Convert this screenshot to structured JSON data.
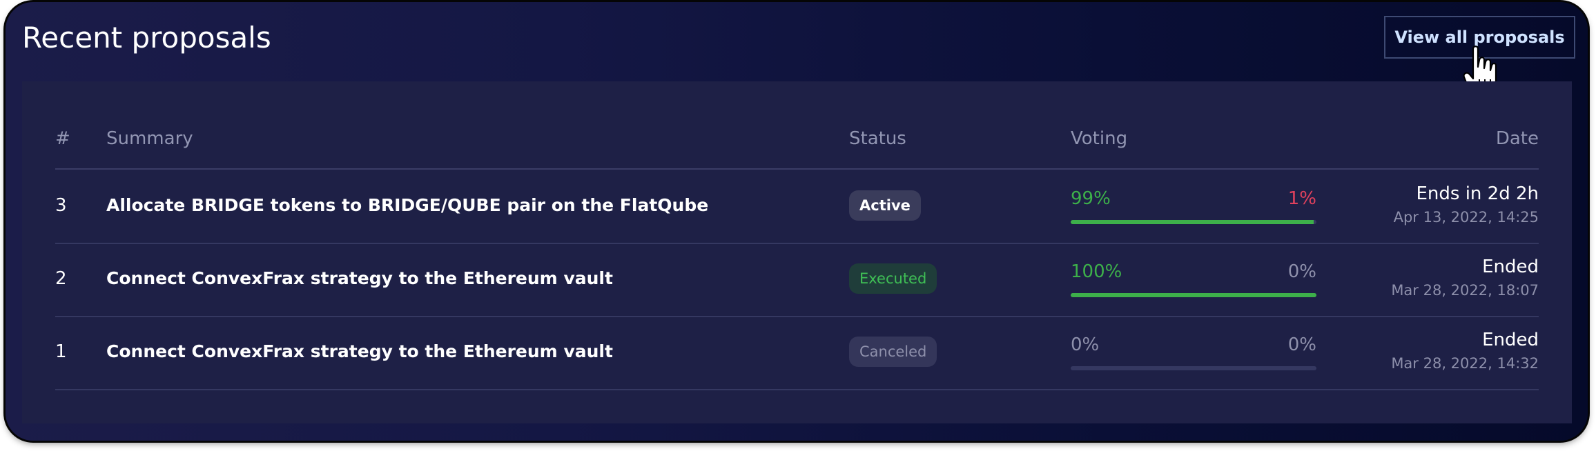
{
  "header": {
    "title": "Recent proposals",
    "view_all_label": "View all proposals"
  },
  "table": {
    "columns": {
      "number": "#",
      "summary": "Summary",
      "status": "Status",
      "voting": "Voting",
      "date": "Date"
    },
    "rows": [
      {
        "number": "3",
        "summary": "Allocate BRIDGE tokens to BRIDGE/QUBE pair on the FlatQube",
        "status": "Active",
        "yes": "99%",
        "no": "1%",
        "yes_fraction": 0.99,
        "date_main": "Ends in 2d 2h",
        "date_sub": "Apr 13, 2022, 14:25"
      },
      {
        "number": "2",
        "summary": "Connect ConvexFrax strategy to the Ethereum vault",
        "status": "Executed",
        "yes": "100%",
        "no": "0%",
        "yes_fraction": 1.0,
        "date_main": "Ended",
        "date_sub": "Mar 28, 2022, 18:07"
      },
      {
        "number": "1",
        "summary": "Connect ConvexFrax strategy to the Ethereum vault",
        "status": "Canceled",
        "yes": "0%",
        "no": "0%",
        "yes_fraction": 0.0,
        "date_main": "Ended",
        "date_sub": "Mar 28, 2022, 14:32"
      }
    ]
  },
  "colors": {
    "yes_green": "#3db04a",
    "no_red": "#e0415d",
    "neutral_gray": "#8e90ab",
    "panel_bg": "#1e2046",
    "frame_bg": "#050b2e",
    "executed_green": "#3fbf55"
  },
  "icons": {
    "cursor": "hand-pointer-icon"
  }
}
